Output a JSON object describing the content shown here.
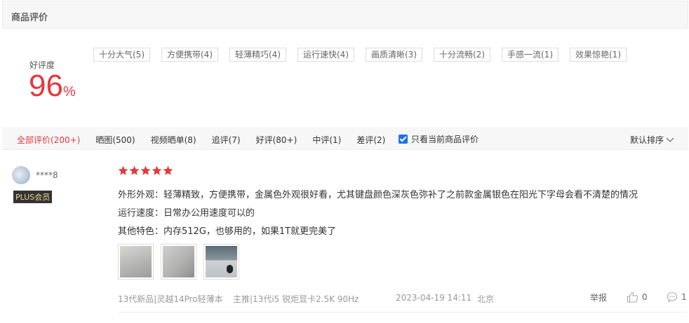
{
  "header": {
    "title": "商品评价"
  },
  "rating": {
    "label": "好评度",
    "value": "96",
    "unit": "%"
  },
  "tags": [
    "十分大气(5)",
    "方便携带(4)",
    "轻薄精巧(4)",
    "运行速快(4)",
    "画质清晰(3)",
    "十分流畅(2)",
    "手感一流(1)",
    "效果惊艳(1)"
  ],
  "filters": [
    "全部评价(200+)",
    "晒图(500)",
    "视频晒单(8)",
    "追评(7)",
    "好评(80+)",
    "中评(1)",
    "差评(2)"
  ],
  "only_current_label": "只看当前商品评价",
  "sort_label": "默认排序",
  "colors": {
    "accent": "#e4393c",
    "checkbox": "#1a73e8"
  },
  "review": {
    "user": {
      "name": "****8",
      "badge": "PLUS会员"
    },
    "stars": 5,
    "lines": [
      "外形外观：轻薄精致，方便携带，金属色外观很好看，尤其键盘颜色深灰色弥补了之前款金属银色在阳光下字母会看不清楚的情况",
      "运行速度：日常办公用速度可以的",
      "其他特色：内存512G，也够用的，如果1T就更完美了"
    ],
    "photo_count": 3,
    "product": "13代新品|灵越14Pro轻薄本",
    "spec": "主推|13代i5 锐炬显卡2.5K 90Hz",
    "date": "2023-04-19 14:11",
    "location": "北京",
    "report_label": "举报",
    "likes": "0",
    "comments": "1"
  }
}
